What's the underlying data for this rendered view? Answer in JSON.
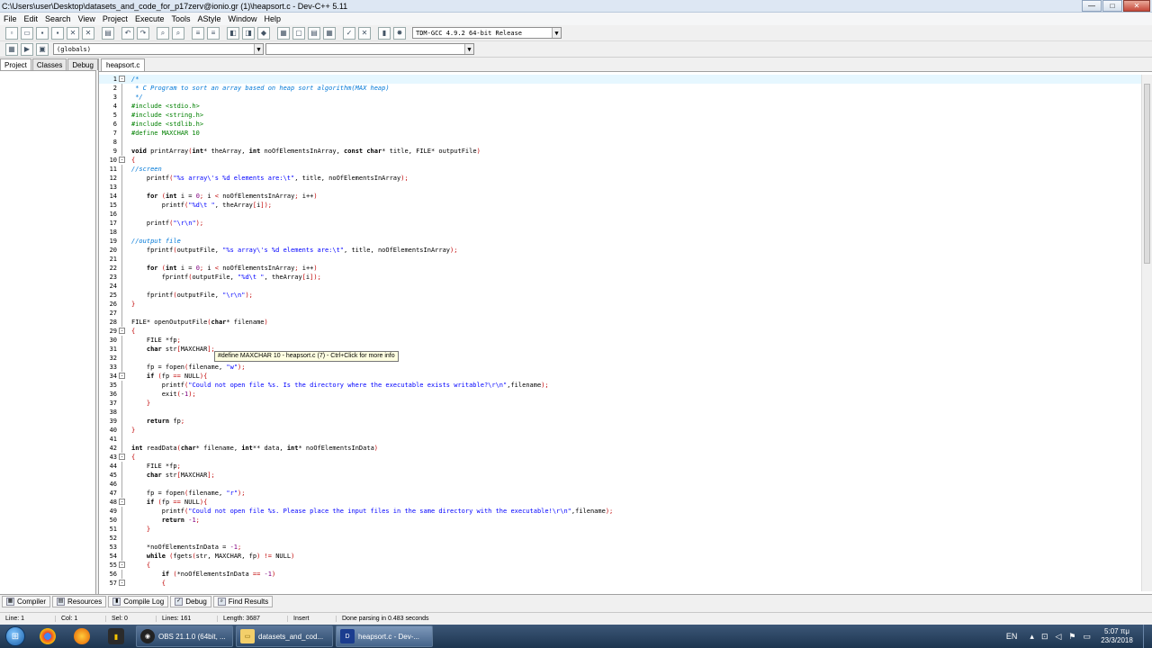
{
  "window": {
    "title": "C:\\Users\\user\\Desktop\\datasets_and_code_for_p17zerv@ionio.gr (1)\\heapsort.c - Dev-C++ 5.11",
    "minimize": "—",
    "maximize": "□",
    "close": "✕"
  },
  "menu": [
    "File",
    "Edit",
    "Search",
    "View",
    "Project",
    "Execute",
    "Tools",
    "AStyle",
    "Window",
    "Help"
  ],
  "toolbar": {
    "compiler_select": "TDM-GCC 4.9.2 64-bit Release",
    "scope_select": "(globals)",
    "member_select": ""
  },
  "left_panel": {
    "tabs": [
      "Project",
      "Classes",
      "Debug"
    ]
  },
  "editor": {
    "tab": "heapsort.c",
    "tooltip": "#define MAXCHAR 10 - heapsort.c (7) - Ctrl+Click for more info",
    "lines": [
      {
        "n": "1",
        "t": "/*",
        "c": "cmt",
        "fold": "-"
      },
      {
        "n": "2",
        "t": " * C Program to sort an array based on heap sort algorithm(MAX heap)",
        "c": "cmt"
      },
      {
        "n": "3",
        "t": " */",
        "c": "cmt"
      },
      {
        "n": "4",
        "t": "#include <stdio.h>",
        "c": "pp"
      },
      {
        "n": "5",
        "t": "#include <string.h>",
        "c": "pp"
      },
      {
        "n": "6",
        "t": "#include <stdlib.h>",
        "c": "pp"
      },
      {
        "n": "7",
        "t": "#define MAXCHAR 10",
        "c": "pp"
      },
      {
        "n": "8",
        "t": "",
        "c": ""
      },
      {
        "n": "9",
        "t": "void printArray(int* theArray, int noOfElementsInArray, const char* title, FILE* outputFile)",
        "c": ""
      },
      {
        "n": "10",
        "t": "{",
        "c": "sym",
        "fold": "-"
      },
      {
        "n": "11",
        "t": "//screen",
        "c": "cmt"
      },
      {
        "n": "12",
        "t": "    printf(\"%s array\\'s %d elements are:\\t\", title, noOfElementsInArray);",
        "c": ""
      },
      {
        "n": "13",
        "t": "",
        "c": ""
      },
      {
        "n": "14",
        "t": "    for (int i = 0; i < noOfElementsInArray; i++)",
        "c": ""
      },
      {
        "n": "15",
        "t": "        printf(\"%d\\t \", theArray[i]);",
        "c": ""
      },
      {
        "n": "16",
        "t": "",
        "c": ""
      },
      {
        "n": "17",
        "t": "    printf(\"\\r\\n\");",
        "c": ""
      },
      {
        "n": "18",
        "t": "",
        "c": ""
      },
      {
        "n": "19",
        "t": "//output file",
        "c": "cmt"
      },
      {
        "n": "20",
        "t": "    fprintf(outputFile, \"%s array\\'s %d elements are:\\t\", title, noOfElementsInArray);",
        "c": ""
      },
      {
        "n": "21",
        "t": "",
        "c": ""
      },
      {
        "n": "22",
        "t": "    for (int i = 0; i < noOfElementsInArray; i++)",
        "c": ""
      },
      {
        "n": "23",
        "t": "        fprintf(outputFile, \"%d\\t \", theArray[i]);",
        "c": ""
      },
      {
        "n": "24",
        "t": "",
        "c": ""
      },
      {
        "n": "25",
        "t": "    fprintf(outputFile, \"\\r\\n\");",
        "c": ""
      },
      {
        "n": "26",
        "t": "}",
        "c": "sym"
      },
      {
        "n": "27",
        "t": "",
        "c": ""
      },
      {
        "n": "28",
        "t": "FILE* openOutputFile(char* filename)",
        "c": ""
      },
      {
        "n": "29",
        "t": "{",
        "c": "sym",
        "fold": "-"
      },
      {
        "n": "30",
        "t": "    FILE *fp;",
        "c": ""
      },
      {
        "n": "31",
        "t": "    char str[MAXCHAR];",
        "c": ""
      },
      {
        "n": "32",
        "t": "",
        "c": ""
      },
      {
        "n": "33",
        "t": "    fp = fopen(filename, \"w\");",
        "c": ""
      },
      {
        "n": "34",
        "t": "    if (fp == NULL){",
        "c": "",
        "fold": "-"
      },
      {
        "n": "35",
        "t": "        printf(\"Could not open file %s. Is the directory where the executable exists writable?\\r\\n\",filename);",
        "c": ""
      },
      {
        "n": "36",
        "t": "        exit(-1);",
        "c": ""
      },
      {
        "n": "37",
        "t": "    }",
        "c": "sym"
      },
      {
        "n": "38",
        "t": "",
        "c": ""
      },
      {
        "n": "39",
        "t": "    return fp;",
        "c": ""
      },
      {
        "n": "40",
        "t": "}",
        "c": "sym"
      },
      {
        "n": "41",
        "t": "",
        "c": ""
      },
      {
        "n": "42",
        "t": "int readData(char* filename, int** data, int* noOfElementsInData)",
        "c": ""
      },
      {
        "n": "43",
        "t": "{",
        "c": "sym",
        "fold": "-"
      },
      {
        "n": "44",
        "t": "    FILE *fp;",
        "c": ""
      },
      {
        "n": "45",
        "t": "    char str[MAXCHAR];",
        "c": ""
      },
      {
        "n": "46",
        "t": "",
        "c": ""
      },
      {
        "n": "47",
        "t": "    fp = fopen(filename, \"r\");",
        "c": ""
      },
      {
        "n": "48",
        "t": "    if (fp == NULL){",
        "c": "",
        "fold": "-"
      },
      {
        "n": "49",
        "t": "        printf(\"Could not open file %s. Please place the input files in the same directory with the executable!\\r\\n\",filename);",
        "c": ""
      },
      {
        "n": "50",
        "t": "        return -1;",
        "c": ""
      },
      {
        "n": "51",
        "t": "    }",
        "c": "sym"
      },
      {
        "n": "52",
        "t": "",
        "c": ""
      },
      {
        "n": "53",
        "t": "    *noOfElementsInData = -1;",
        "c": ""
      },
      {
        "n": "54",
        "t": "    while (fgets(str, MAXCHAR, fp) != NULL)",
        "c": ""
      },
      {
        "n": "55",
        "t": "    {",
        "c": "sym",
        "fold": "-"
      },
      {
        "n": "56",
        "t": "        if (*noOfElementsInData == -1)",
        "c": ""
      },
      {
        "n": "57",
        "t": "        {",
        "c": "sym",
        "fold": "-"
      }
    ]
  },
  "bottom_tabs": [
    "Compiler",
    "Resources",
    "Compile Log",
    "Debug",
    "Find Results"
  ],
  "status": {
    "line": "Line:   1",
    "col": "Col:   1",
    "sel": "Sel:   0",
    "lines": "Lines:   161",
    "length": "Length:   3687",
    "mode": "Insert",
    "message": "Done parsing in 0.483 seconds"
  },
  "taskbar": {
    "tasks": [
      {
        "label": "OBS 21.1.0 (64bit, ...",
        "icon": "obs-icon"
      },
      {
        "label": "datasets_and_cod...",
        "icon": "folder-icon"
      },
      {
        "label": "heapsort.c - Dev-...",
        "icon": "devcpp-icon"
      }
    ],
    "lang": "EN",
    "time": "5:07 πμ",
    "date": "23/3/2018"
  }
}
